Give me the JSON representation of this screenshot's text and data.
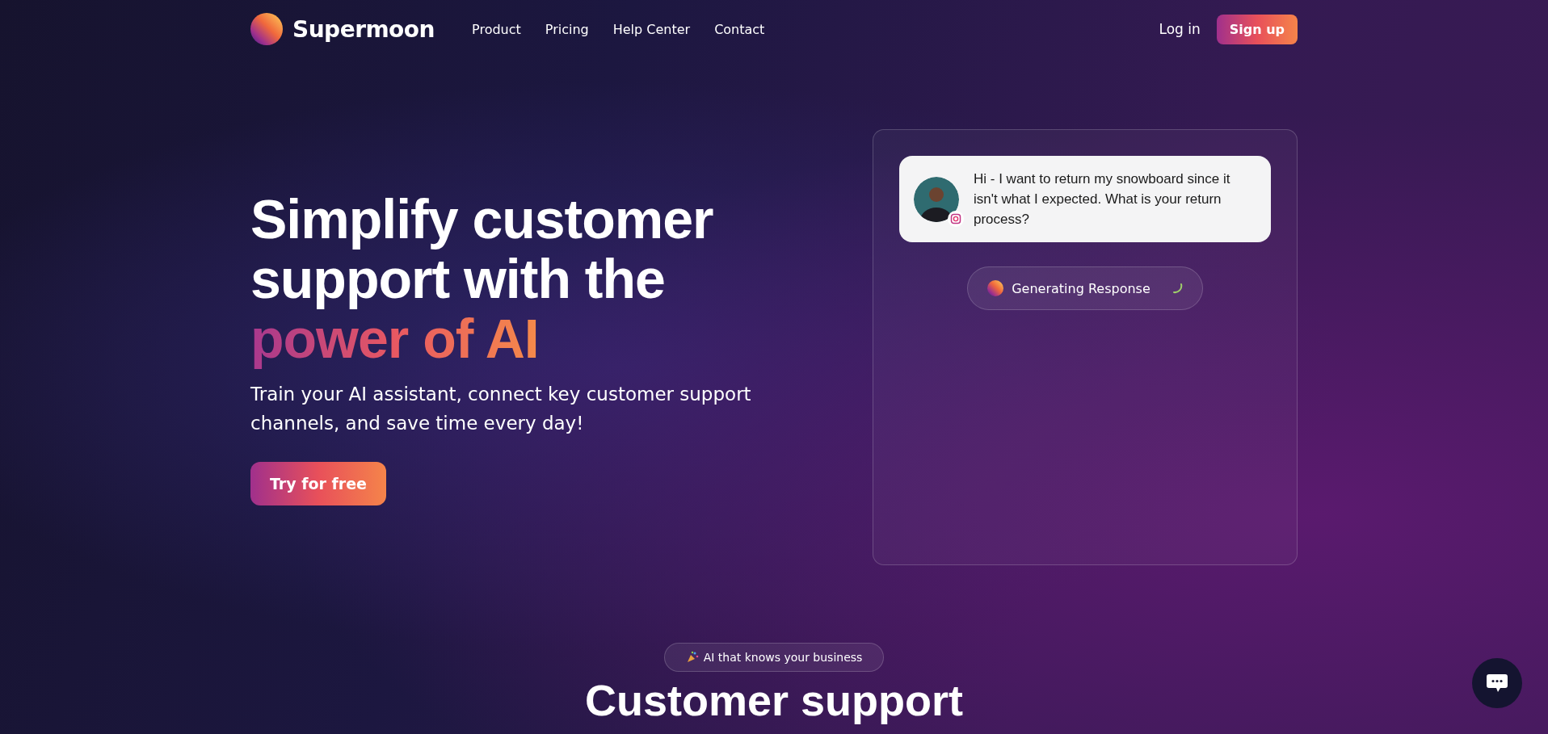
{
  "brand": {
    "name": "Supermoon"
  },
  "nav": {
    "links": [
      "Product",
      "Pricing",
      "Help Center",
      "Contact"
    ],
    "login": "Log in",
    "signup": "Sign up"
  },
  "hero": {
    "headline": "Simplify customer support with the",
    "highlight": "power of AI",
    "subtitle": "Train your AI assistant, connect key customer support channels, and save time every day!",
    "cta": "Try for free"
  },
  "chat": {
    "message": "Hi - I want to return my snowboard since it isn't what I expected. What is your return process?",
    "status": "Generating Response"
  },
  "section": {
    "badge": "AI that knows your business",
    "title": "Customer support"
  }
}
